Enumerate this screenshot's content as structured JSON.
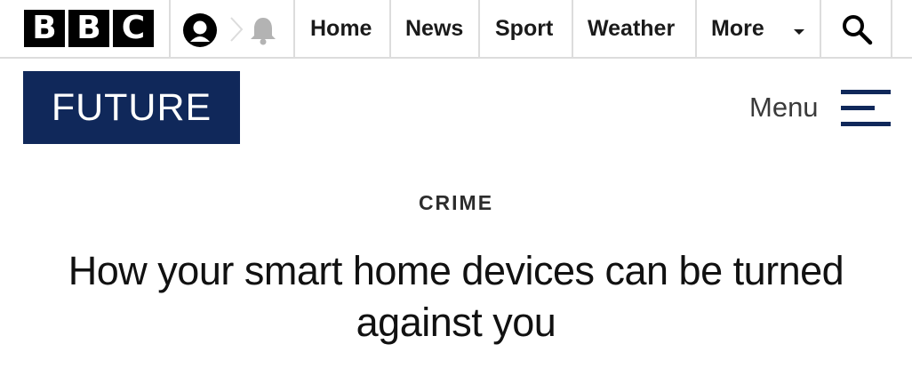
{
  "brand": {
    "letters": [
      "B",
      "B",
      "C"
    ]
  },
  "icons": {
    "account": "account-icon",
    "notifications": "bell-icon",
    "search": "search-icon",
    "menu": "hamburger-menu-icon"
  },
  "nav": {
    "home": "Home",
    "news": "News",
    "sport": "Sport",
    "weather": "Weather",
    "more": "More"
  },
  "section": {
    "name": "FUTURE",
    "menu_label": "Menu"
  },
  "article": {
    "category": "CRIME",
    "headline": "How your smart home devices can be turned against you"
  },
  "colors": {
    "brand_navy": "#10285a",
    "black": "#000000",
    "divider": "#dcdcdc",
    "bell_gray": "#b3b3b3"
  }
}
